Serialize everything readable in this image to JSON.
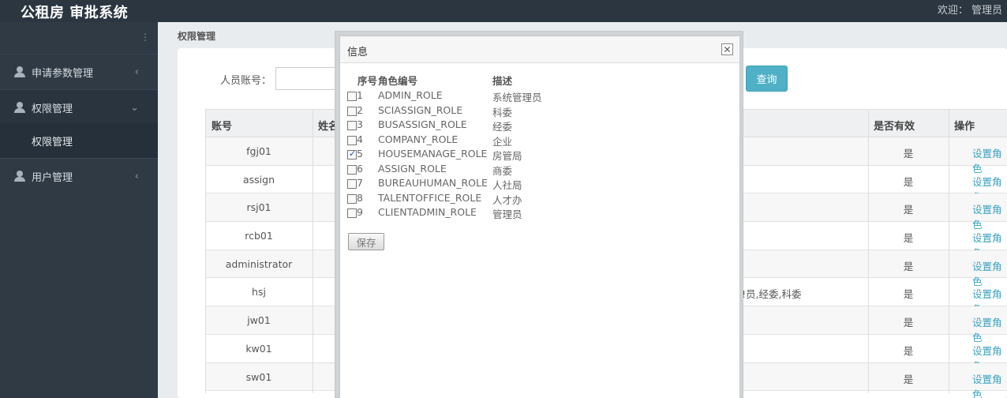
{
  "app": {
    "title": "公租房 审批系统",
    "welcome": "欢迎： 管理员"
  },
  "sidebar": {
    "items": [
      {
        "label": "申请参数管理",
        "arrow": "‹"
      },
      {
        "label": "权限管理",
        "arrow": "⌄",
        "sub": "权限管理"
      },
      {
        "label": "用户管理",
        "arrow": "‹"
      }
    ]
  },
  "content": {
    "breadcrumb": "权限管理",
    "search_label": "人员账号：",
    "query_label": "查询",
    "columns": {
      "account": "账号",
      "name": "姓名",
      "valid": "是否有效",
      "action": "操作"
    },
    "rows": [
      {
        "account": "fgj01",
        "extra": "",
        "valid": "是",
        "action": "设置角色"
      },
      {
        "account": "assign",
        "extra": "",
        "valid": "是",
        "action": "设置角色"
      },
      {
        "account": "rsj01",
        "extra": "",
        "valid": "是",
        "action": "设置角色"
      },
      {
        "account": "rcb01",
        "extra": "",
        "valid": "是",
        "action": "设置角色"
      },
      {
        "account": "administrator",
        "extra": "",
        "valid": "是",
        "action": "设置角色"
      },
      {
        "account": "hsj",
        "extra": "!员,经委,科委",
        "valid": "是",
        "action": "设置角色"
      },
      {
        "account": "jw01",
        "extra": "",
        "valid": "是",
        "action": "设置角色"
      },
      {
        "account": "kw01",
        "extra": "",
        "valid": "是",
        "action": "设置角色"
      },
      {
        "account": "sw01",
        "extra": "",
        "valid": "是",
        "action": "设置角色"
      }
    ]
  },
  "modal": {
    "title": "信息",
    "header_num": "序号",
    "header_code": "角色编号",
    "header_desc": "描述",
    "roles": [
      {
        "num": "1",
        "code": "ADMIN_ROLE",
        "desc": "系统管理员",
        "checked": false
      },
      {
        "num": "2",
        "code": "SCIASSIGN_ROLE",
        "desc": "科委",
        "checked": false
      },
      {
        "num": "3",
        "code": "BUSASSIGN_ROLE",
        "desc": "经委",
        "checked": false
      },
      {
        "num": "4",
        "code": "COMPANY_ROLE",
        "desc": "企业",
        "checked": false
      },
      {
        "num": "5",
        "code": "HOUSEMANAGE_ROLE",
        "desc": "房管局",
        "checked": true
      },
      {
        "num": "6",
        "code": "ASSIGN_ROLE",
        "desc": "商委",
        "checked": false
      },
      {
        "num": "7",
        "code": "BUREAUHUMAN_ROLE",
        "desc": "人社局",
        "checked": false
      },
      {
        "num": "8",
        "code": "TALENTOFFICE_ROLE",
        "desc": "人才办",
        "checked": false
      },
      {
        "num": "9",
        "code": "CLIENTADMIN_ROLE",
        "desc": "管理员",
        "checked": false
      }
    ],
    "save_label": "保存"
  }
}
